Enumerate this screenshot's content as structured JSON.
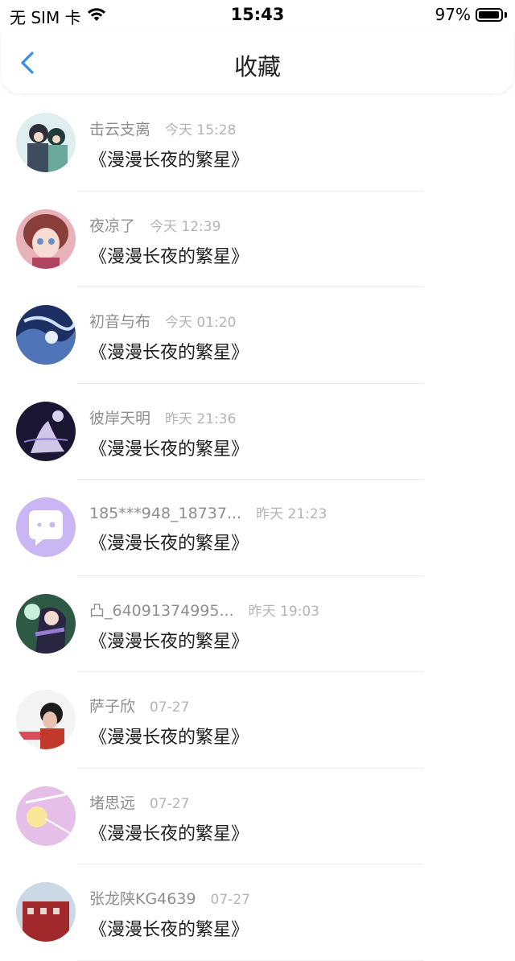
{
  "status": {
    "carrier": "无 SIM 卡",
    "time": "15:43",
    "battery": "97%",
    "battery_level": 0.97
  },
  "nav": {
    "title": "收藏",
    "back_icon": "chevron-left-icon"
  },
  "colors": {
    "accent": "#3a8ee6"
  },
  "items": [
    {
      "name": "击云支离",
      "time": "今天 15:28",
      "title": "《漫漫长夜的繁星》",
      "avatar": "anime-avatar-teal"
    },
    {
      "name": "夜凉了",
      "time": "今天 12:39",
      "title": "《漫漫长夜的繁星》",
      "avatar": "anime-avatar-pink"
    },
    {
      "name": "初音与布",
      "time": "今天 01:20",
      "title": "《漫漫长夜的繁星》",
      "avatar": "anime-avatar-blue"
    },
    {
      "name": "彼岸天明",
      "time": "昨天 21:36",
      "title": "《漫漫长夜的繁星》",
      "avatar": "anime-avatar-dark"
    },
    {
      "name": "185***948_18737...",
      "time": "昨天 21:23",
      "title": "《漫漫长夜的繁星》",
      "avatar": "default-chat-avatar"
    },
    {
      "name": "凸_64091374995...",
      "time": "昨天 19:03",
      "title": "《漫漫长夜的繁星》",
      "avatar": "anime-avatar-green"
    },
    {
      "name": "萨子欣",
      "time": "07-27",
      "title": "《漫漫长夜的繁星》",
      "avatar": "photo-avatar-person"
    },
    {
      "name": "堵思远",
      "time": "07-27",
      "title": "《漫漫长夜的繁星》",
      "avatar": "anime-avatar-lilac"
    },
    {
      "name": "张龙陕KG4639",
      "time": "07-27",
      "title": "《漫漫长夜的繁星》",
      "avatar": "photo-avatar-building"
    }
  ]
}
